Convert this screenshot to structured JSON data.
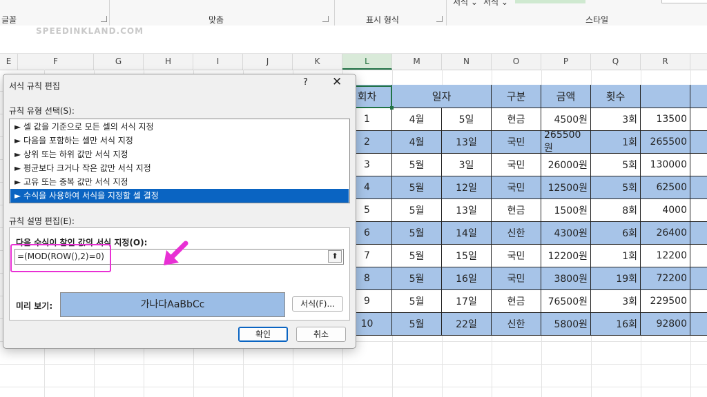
{
  "ribbon": {
    "groups": [
      "글꼴",
      "맞춤",
      "표시 형식",
      "스타일"
    ],
    "top_items": [
      "서식 ⌄",
      "서식 ⌄"
    ]
  },
  "watermark": "SPEEDINKLAND.COM",
  "columns": [
    "E",
    "F",
    "G",
    "H",
    "I",
    "J",
    "K",
    "L",
    "M",
    "N",
    "O",
    "P",
    "Q",
    "R"
  ],
  "selected_column": "L",
  "table": {
    "headers": [
      "회차",
      "일자",
      "구분",
      "금액",
      "횟수"
    ],
    "rows": [
      {
        "n": "1",
        "m": "4월",
        "d": "5일",
        "k": "현금",
        "amt": "4500원",
        "cnt": "3회",
        "tot": "13500"
      },
      {
        "n": "2",
        "m": "4월",
        "d": "13일",
        "k": "국민",
        "amt": "265500원",
        "cnt": "1회",
        "tot": "265500"
      },
      {
        "n": "3",
        "m": "5월",
        "d": "3일",
        "k": "국민",
        "amt": "26000원",
        "cnt": "5회",
        "tot": "130000"
      },
      {
        "n": "4",
        "m": "5월",
        "d": "12일",
        "k": "국민",
        "amt": "12500원",
        "cnt": "5회",
        "tot": "62500"
      },
      {
        "n": "5",
        "m": "5월",
        "d": "13일",
        "k": "현금",
        "amt": "1500원",
        "cnt": "8회",
        "tot": "4000"
      },
      {
        "n": "6",
        "m": "5월",
        "d": "14일",
        "k": "신한",
        "amt": "4300원",
        "cnt": "6회",
        "tot": "26400"
      },
      {
        "n": "7",
        "m": "5월",
        "d": "15일",
        "k": "국민",
        "amt": "12200원",
        "cnt": "1회",
        "tot": "12200"
      },
      {
        "n": "8",
        "m": "5월",
        "d": "16일",
        "k": "국민",
        "amt": "3800원",
        "cnt": "19회",
        "tot": "72200"
      },
      {
        "n": "9",
        "m": "5월",
        "d": "17일",
        "k": "현금",
        "amt": "76500원",
        "cnt": "3회",
        "tot": "229500"
      },
      {
        "n": "10",
        "m": "5월",
        "d": "22일",
        "k": "신한",
        "amt": "5800원",
        "cnt": "16회",
        "tot": "92800"
      }
    ]
  },
  "dialog": {
    "title": "서식 규칙 편집",
    "help": "?",
    "close": "✕",
    "rule_type_label": "규칙 유형 선택(S):",
    "rule_types": [
      "► 셀 값을 기준으로 모든 셀의 서식 지정",
      "► 다음을 포함하는 셀만 서식 지정",
      "► 상위 또는 하위 값만 서식 지정",
      "► 평균보다 크거나 작은 값만 서식 지정",
      "► 고유 또는 중복 값만 서식 지정",
      "► 수식을 사용하여 서식을 지정할 셀 결정"
    ],
    "selected_rule_index": 5,
    "edit_label": "규칙 설명 편집(E):",
    "formula_label": "다음 수식이 참인 값의 서식 지정(O):",
    "formula_value": "=(MOD(ROW(),2)=0)",
    "collapse_glyph": "⬆",
    "preview_label": "미리 보기:",
    "preview_text": "가나다AaBbCc",
    "format_button": "서식(F)...",
    "ok_button": "확인",
    "cancel_button": "취소"
  },
  "colors": {
    "highlight": "#e830d4",
    "selection": "#0a64c2",
    "table_fill": "#a7c4e8",
    "preview_fill": "#9bbde6",
    "excel_green": "#217346"
  }
}
